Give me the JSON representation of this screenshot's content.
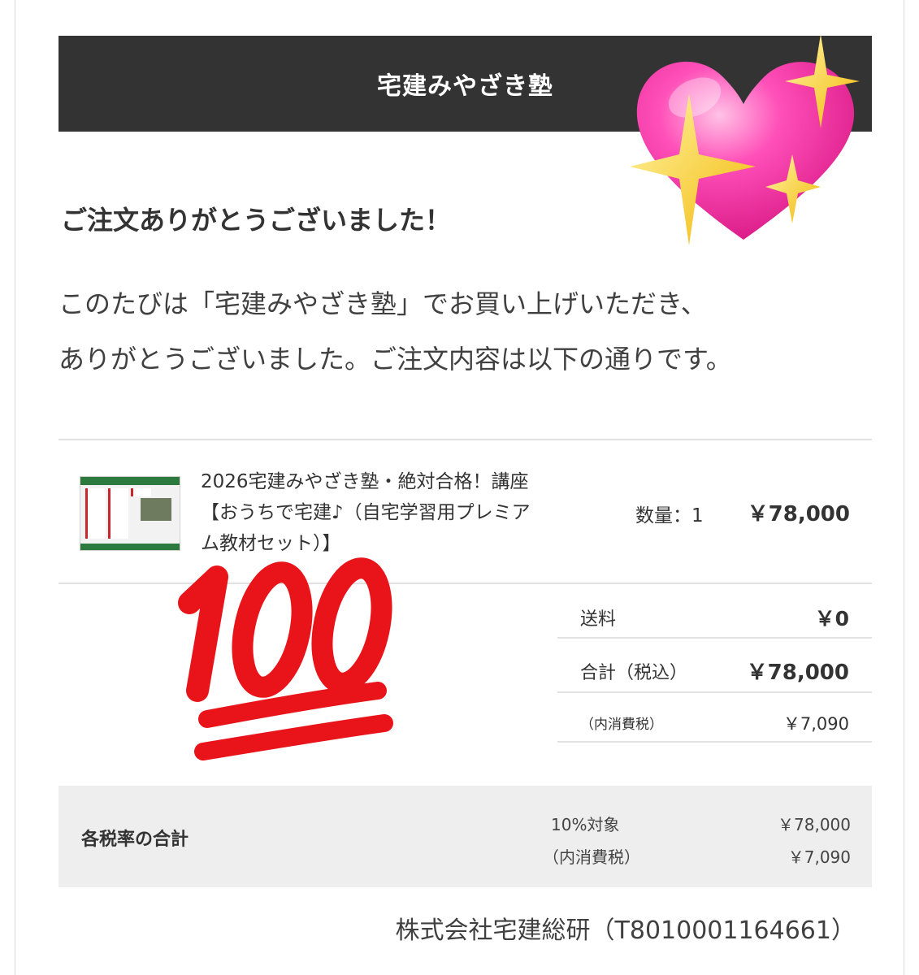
{
  "shop": {
    "name": "宅建みやざき塾"
  },
  "heading": "ご注文ありがとうございました！",
  "message": {
    "line1": "このたびは「宅建みやざき塾」でお買い上げいただき、",
    "line2": "ありがとうございました。ご注文内容は以下の通りです。"
  },
  "order": {
    "item": {
      "name_lines": [
        "2026宅建みやざき塾・絶対合格！講座",
        "【おうちで宅建♪（自宅学習用プレミア",
        "ム教材セット）】"
      ],
      "quantity": "数量：1",
      "price": "￥78,000"
    },
    "summary": {
      "shipping_label": "送料",
      "shipping_value": "￥0",
      "total_label": "合計（税込）",
      "total_value": "￥78,000",
      "tax_label": "（内消費税）",
      "tax_value": "￥7,090"
    },
    "tax_breakdown": {
      "title": "各税率の合計",
      "rate_label": "10%対象",
      "rate_value": "￥78,000",
      "tax_label": "（内消費税）",
      "tax_value": "￥7,090"
    }
  },
  "company": "株式会社宅建総研（T8010001164661）",
  "decorations": {
    "heart": "sparkling-heart-emoji",
    "hundred": "hundred-points-emoji"
  },
  "colors": {
    "header_bg": "#333333",
    "tax_box_bg": "#eeeeee",
    "heart": "#ff3fa6",
    "sparkle": "#ffd43b",
    "hundred": "#e8141a"
  }
}
